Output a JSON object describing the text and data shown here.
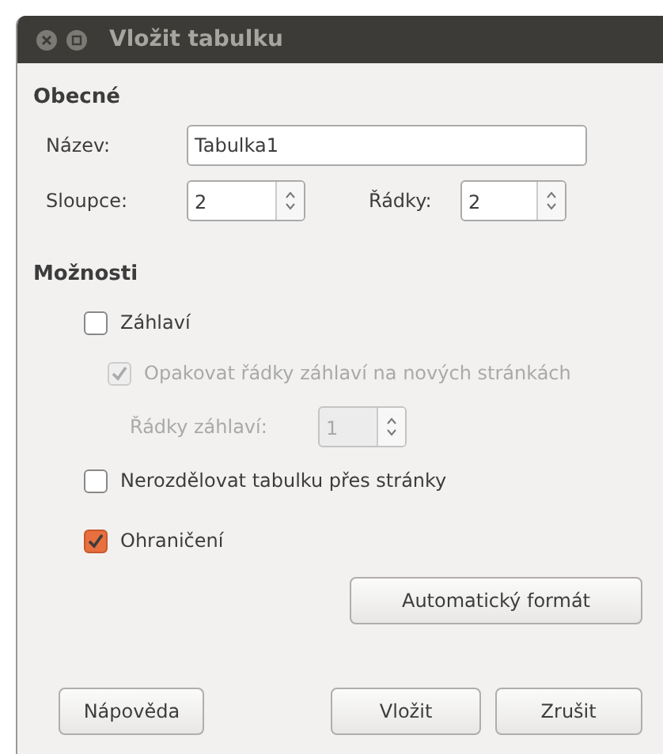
{
  "window": {
    "title": "Vložit tabulku"
  },
  "general": {
    "heading": "Obecné",
    "name": {
      "label": "Název:",
      "value": "Tabulka1"
    },
    "columns": {
      "label": "Sloupce:",
      "value": "2"
    },
    "rows": {
      "label": "Řádky:",
      "value": "2"
    }
  },
  "options": {
    "heading": "Možnosti",
    "items": [
      {
        "kind": "checkbox",
        "label": "Záhlaví",
        "checked": false,
        "disabled": false,
        "indented": false
      },
      {
        "kind": "checkbox",
        "label": "Opakovat řádky záhlaví na nových stránkách",
        "checked": true,
        "disabled": true,
        "indented": true
      },
      {
        "kind": "spinner",
        "label": "Řádky záhlaví:",
        "value": "1",
        "disabled": true,
        "indented": true
      },
      {
        "kind": "checkbox",
        "label": "Nerozdělovat tabulku přes stránky",
        "checked": false,
        "disabled": false,
        "indented": false
      },
      {
        "kind": "checkbox",
        "label": "Ohraničení",
        "checked": true,
        "disabled": false,
        "indented": false
      }
    ]
  },
  "autoformat_button": "Automatický formát",
  "buttons": [
    {
      "label": "Nápověda"
    },
    {
      "label": "Vložit"
    },
    {
      "label": "Zrušit"
    }
  ]
}
